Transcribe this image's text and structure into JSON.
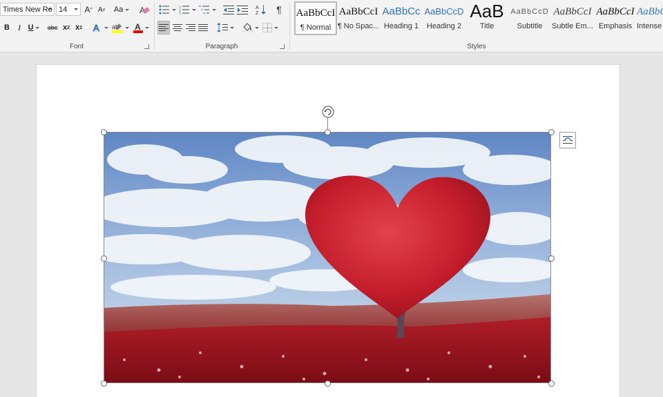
{
  "font": {
    "family": "Times New Ro",
    "size": "14",
    "grow": "A",
    "shrink": "A",
    "change_case": "Aa",
    "bold": "B",
    "italic": "I",
    "underline": "U",
    "strike": "abc",
    "subscript": "x",
    "subscript_sub": "2",
    "superscript": "x",
    "superscript_sup": "2",
    "font_color_glyph": "A",
    "label": "Font"
  },
  "paragraph": {
    "pilcrow": "¶",
    "label": "Paragraph"
  },
  "styles": {
    "label": "Styles",
    "items": [
      {
        "preview": "AaBbCcI",
        "name": "¶ Normal"
      },
      {
        "preview": "AaBbCcI",
        "name": "¶ No Spac..."
      },
      {
        "preview": "AaBbCc",
        "name": "Heading 1"
      },
      {
        "preview": "AaBbCcD",
        "name": "Heading 2"
      },
      {
        "preview": "AaB",
        "name": "Title"
      },
      {
        "preview": "AaBbCcD",
        "name": "Subtitle"
      },
      {
        "preview": "AaBbCcI",
        "name": "Subtle Em..."
      },
      {
        "preview": "AaBbCcI",
        "name": "Emphasis"
      },
      {
        "preview": "AaBbCcI",
        "name": "Intense"
      }
    ]
  },
  "colors": {
    "ribbon_bg": "#f3f3f3",
    "heading_blue": "#2e74b5",
    "font_color_red": "#e00000",
    "highlight_yellow": "#ffff00"
  }
}
